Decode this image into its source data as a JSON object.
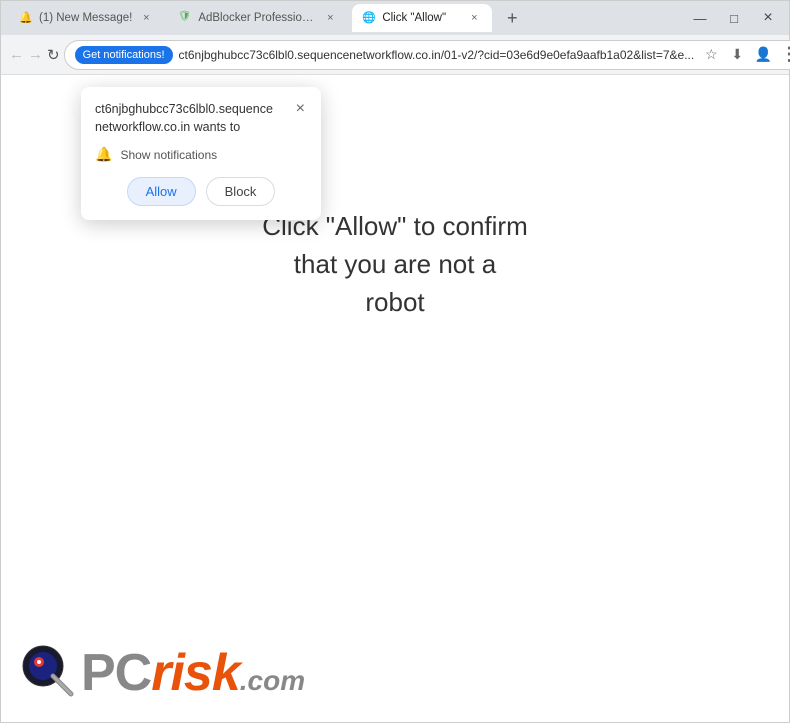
{
  "browser": {
    "title_bar_bg": "#dee1e6"
  },
  "tabs": [
    {
      "id": "tab-1",
      "label": "(1) New Message!",
      "favicon": "bell",
      "active": false,
      "close_label": "×"
    },
    {
      "id": "tab-2",
      "label": "AdBlocker Professional",
      "favicon": "shield",
      "active": false,
      "close_label": "×"
    },
    {
      "id": "tab-3",
      "label": "Click \"Allow\"",
      "favicon": "page",
      "active": true,
      "close_label": "×"
    }
  ],
  "new_tab_label": "+",
  "window_controls": {
    "minimize": "—",
    "maximize": "□",
    "close": "×"
  },
  "navbar": {
    "back": "←",
    "forward": "→",
    "reload": "↻",
    "get_notifications": "Get notifications!",
    "url": "ct6njbghubcc73c6lbl0.sequencenetworkflow.co.in/01-v2/?cid=03e6d9e0efa9aafb1a02&list=7&e...",
    "star_icon": "☆",
    "download_icon": "⬇",
    "account_icon": "👤",
    "menu_icon": "⋮"
  },
  "notification_popup": {
    "site_name": "ct6njbghubcc73c6lbl0.sequence\nnetworkflow.co.in wants to",
    "close_btn": "×",
    "bell_icon": "🔔",
    "show_notifications": "Show notifications",
    "allow_btn": "Allow",
    "block_btn": "Block"
  },
  "main_content": {
    "message_line1": "Click \"Allow\" to confirm",
    "message_line2": "that you are not a",
    "message_line3": "robot"
  },
  "footer": {
    "logo_pc": "PC",
    "logo_risk": "risk",
    "logo_com": ".com"
  }
}
